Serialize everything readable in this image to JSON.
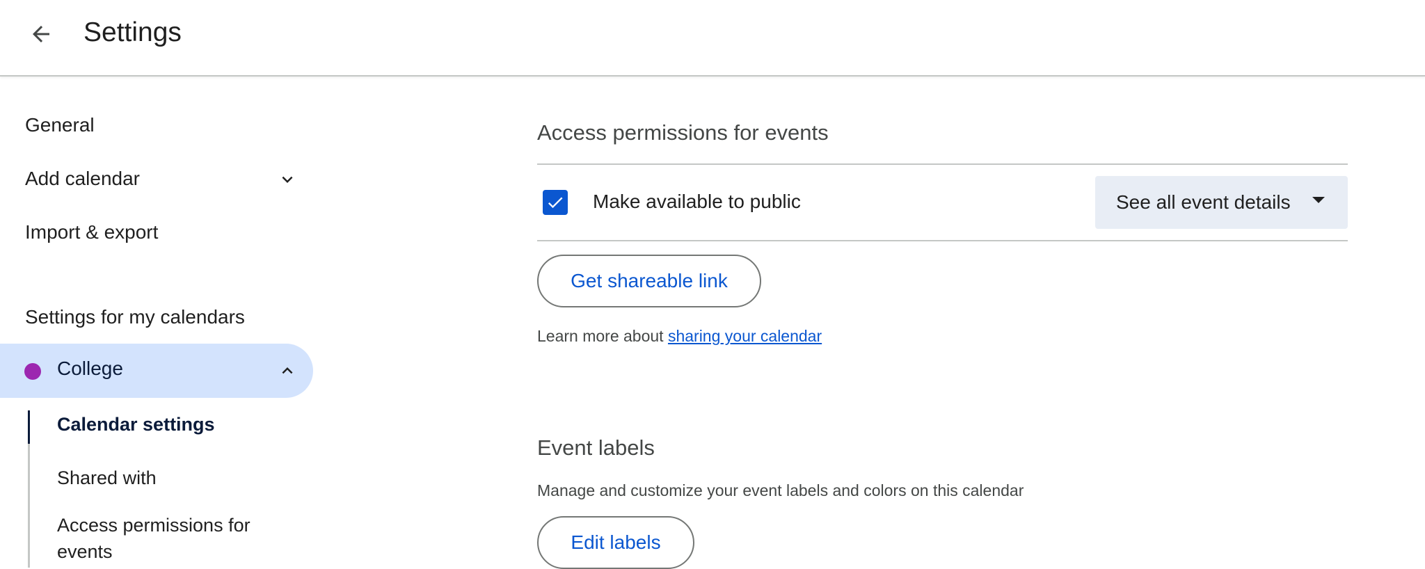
{
  "header": {
    "back_icon": "arrow-back-icon",
    "title": "Settings"
  },
  "sidebar": {
    "items": [
      {
        "label": "General"
      },
      {
        "label": "Add calendar",
        "icon": "chevron-down-icon"
      },
      {
        "label": "Import & export"
      }
    ],
    "section_heading": "Settings for my calendars",
    "calendar": {
      "label": "College",
      "color": "#9c27b0",
      "icon": "chevron-up-icon",
      "subitems": [
        {
          "label": "Calendar settings",
          "active": true
        },
        {
          "label": "Shared with"
        },
        {
          "label": "Access permissions for events"
        }
      ]
    }
  },
  "main": {
    "access": {
      "title": "Access permissions for events",
      "public_checkbox_label": "Make available to public",
      "public_checked": true,
      "detail_select_value": "See all event details",
      "shareable_link_button": "Get shareable link",
      "learn_more_prefix": "Learn more about ",
      "learn_more_link": "sharing your calendar"
    },
    "labels": {
      "title": "Event labels",
      "description": "Manage and customize your event labels and colors on this calendar",
      "edit_button": "Edit labels"
    }
  },
  "colors": {
    "accent": "#0b57d0",
    "selected_bg": "#d3e3fd",
    "select_bg": "#e8edf5"
  }
}
